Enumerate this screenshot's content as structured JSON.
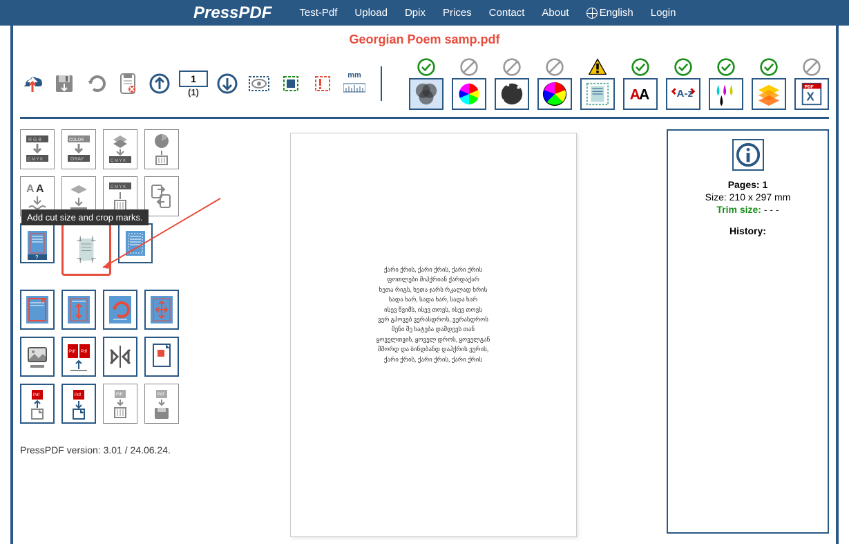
{
  "app": {
    "name": "PressPDF"
  },
  "nav": {
    "items": [
      "Test-Pdf",
      "Upload",
      "Dpix",
      "Prices",
      "Contact",
      "About"
    ],
    "lang": "English",
    "login": "Login"
  },
  "filename": "Georgian Poem samp.pdf",
  "toolbar": {
    "page_current": "1",
    "page_total": "(1)",
    "mm_label": "mm"
  },
  "status_icons": [
    {
      "type": "check"
    },
    {
      "type": "block"
    },
    {
      "type": "block"
    },
    {
      "type": "block"
    },
    {
      "type": "warn"
    },
    {
      "type": "check"
    },
    {
      "type": "check"
    },
    {
      "type": "check"
    },
    {
      "type": "check"
    },
    {
      "type": "block"
    }
  ],
  "tooltip": "Add cut size and crop marks.",
  "info": {
    "pages_label": "Pages:",
    "pages_value": "1",
    "size_label": "Size:",
    "size_value": "210 x 297 mm",
    "trim_label": "Trim size:",
    "trim_value": "- - -",
    "history_label": "History:"
  },
  "poem_lines": [
    "ქარი ქრის, ქარი ქრის, ქარი ქრის",
    "ფოთლები მიჰქრიან ქარდაქარ",
    "ხეთა რიგს, ხეთა ჯარს რკალად ხრის",
    "სადა ხარ, სადა ხარ, სადა ხარ",
    "ისევ წვიმს, ისევ თოვს, ისევ თოვს",
    "ვერ გპოვებ ვერასდროს, ვერასდროს",
    "შენი მე ხატება დამდევს თან",
    "ყოველთვის, ყოველ დროს, ყოველგან",
    "მშორდ და ბინდბანდ დაჰქრის ვერის,",
    "ქარი ქრის, ქარი ქრის, ქარი ქრის"
  ],
  "version": "PressPDF version: 3.01 / 24.06.24."
}
